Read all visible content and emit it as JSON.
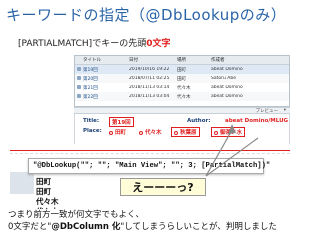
{
  "slide": {
    "title": "キーワードの指定（@DbLookupのみ）",
    "subtitle_prefix": "[PARTIALMATCH]でキーの先頭",
    "subtitle_highlight": "0文字"
  },
  "view": {
    "columns": [
      "タイトル",
      "日付",
      "場所",
      "作成者"
    ],
    "rows": [
      {
        "title": "第19回",
        "date": "2019/10/16 19:22",
        "place": "田町",
        "author": "abeat Domino"
      },
      {
        "title": "第20回",
        "date": "2018/07/11 02:25",
        "place": "田町",
        "author": "Satoru Abe"
      },
      {
        "title": "第21回",
        "date": "2018/11/13 03:14",
        "place": "代々木",
        "author": "abeat Domino"
      },
      {
        "title": "第22回",
        "date": "2018/11/13 03:04",
        "place": "代々木",
        "author": "abeat Domino"
      }
    ],
    "preview_label": "プレビュー"
  },
  "preview": {
    "title_label": "Title:",
    "title_value": "第19回",
    "author_label": "Author:",
    "author_value": "abeat Domino/MLUG",
    "place_label": "Place:",
    "place_options": [
      "田町",
      "代々木",
      "秋葉原",
      "御茶ノ水"
    ]
  },
  "formula": {
    "text": "\"@DbLookup(\"\"; \"\"; \"Main View\"; \"\"; 3; [PartialMatch])\""
  },
  "results": [
    "田町",
    "田町",
    "代々木",
    "代々木"
  ],
  "callout": "えーーーっ?",
  "footer": {
    "line1": "つまり前方一致が何文字でもよく、",
    "line2_prefix": "0文字だと\"",
    "line2_bold": "@DbColumn 化",
    "line2_suffix": "\"してしまうらしいことが、判明しました"
  }
}
